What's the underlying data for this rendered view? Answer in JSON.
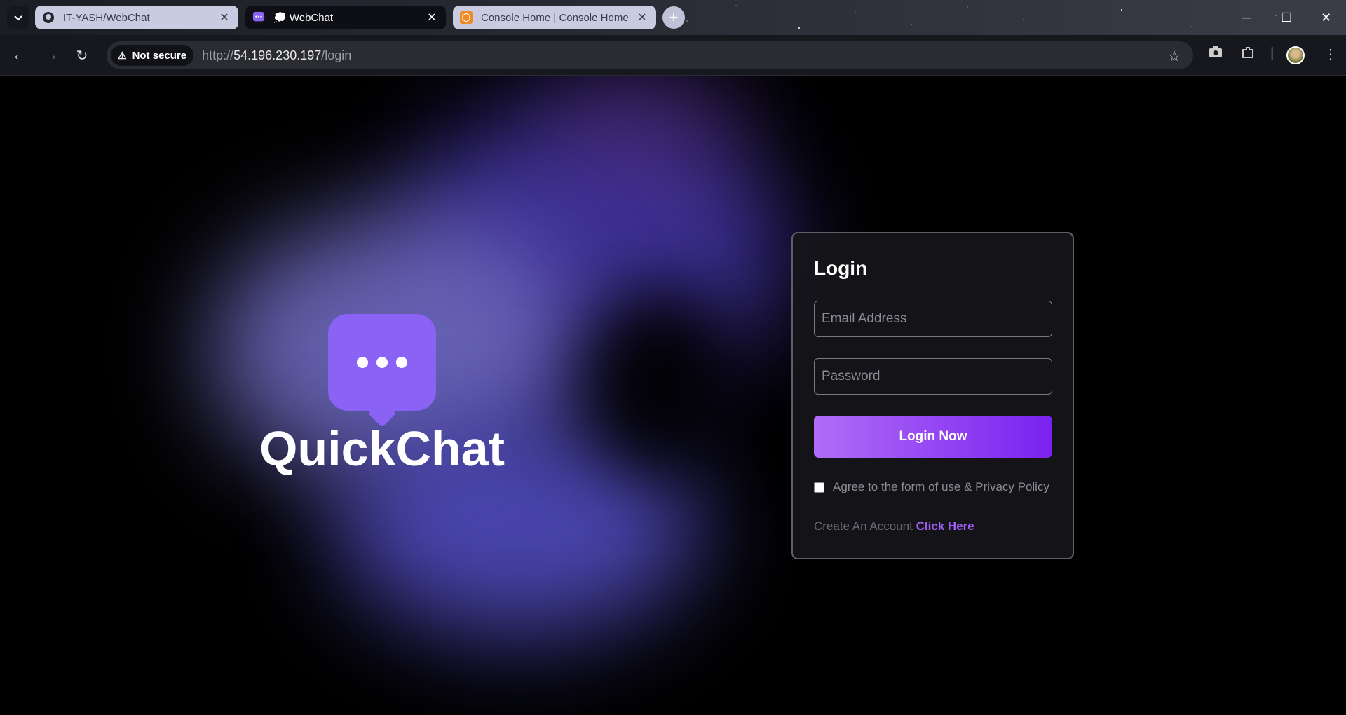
{
  "browser": {
    "tabs": [
      {
        "title": "IT-YASH/WebChat",
        "icon": "github-icon"
      },
      {
        "title": "💭 WebChat",
        "icon": "chat-icon"
      },
      {
        "title": "Console Home | Console Home",
        "icon": "aws-icon"
      }
    ],
    "new_tab_label": "+",
    "security_label": "Not secure",
    "url_scheme": "http://",
    "url_host": "54.196.230.197",
    "url_path": "/login"
  },
  "brand": {
    "name": "QuickChat",
    "logo_color": "#8a63f5"
  },
  "login": {
    "title": "Login",
    "email_placeholder": "Email Address",
    "password_placeholder": "Password",
    "submit_label": "Login Now",
    "agree_label": "Agree to the form of use & Privacy Policy",
    "create_prefix": "Create An Account",
    "create_link": "Click Here",
    "accent_color": "#9f5ff8"
  }
}
